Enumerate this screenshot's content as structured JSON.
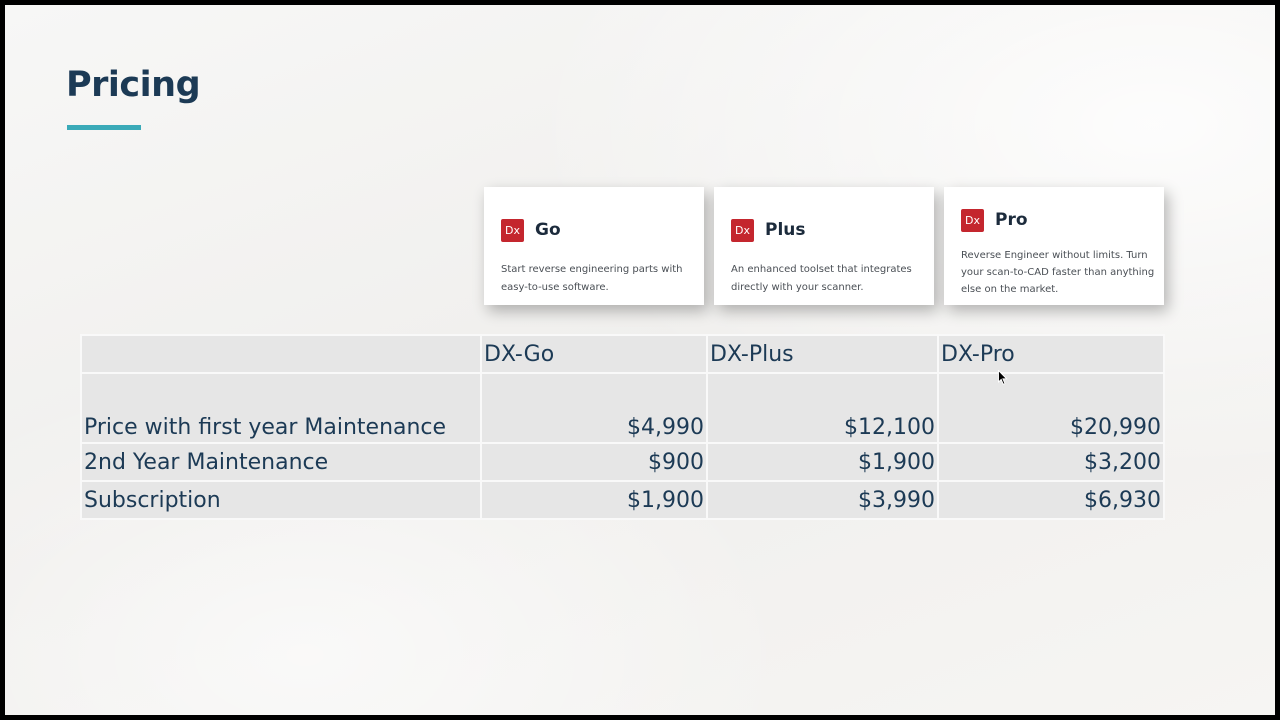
{
  "slide": {
    "title": "Pricing",
    "accent_color": "#3aaab8",
    "title_color": "#1c3a55"
  },
  "products": [
    {
      "logo_text": "Dx",
      "name": "Go",
      "description": "Start reverse engineering parts with easy-to-use software.",
      "logo_color": "#c4262e"
    },
    {
      "logo_text": "Dx",
      "name": "Plus",
      "description": "An enhanced toolset that integrates directly with your scanner.",
      "logo_color": "#c4262e"
    },
    {
      "logo_text": "Dx",
      "name": "Pro",
      "description": "Reverse Engineer without limits. Turn your scan-to-CAD faster than anything else on the market.",
      "logo_color": "#c4262e"
    }
  ],
  "table": {
    "headers": [
      "",
      "DX-Go",
      "DX-Plus",
      "DX-Pro"
    ],
    "rows": [
      {
        "label": "Price with first year Maintenance",
        "values": [
          "$4,990",
          "$12,100",
          "$20,990"
        ]
      },
      {
        "label": "2nd Year Maintenance",
        "values": [
          "$900",
          "$1,900",
          "$3,200"
        ]
      },
      {
        "label": "Subscription",
        "values": [
          "$1,900",
          "$3,990",
          "$6,930"
        ]
      }
    ]
  },
  "icons": {
    "cursor": "mouse-pointer-icon"
  }
}
